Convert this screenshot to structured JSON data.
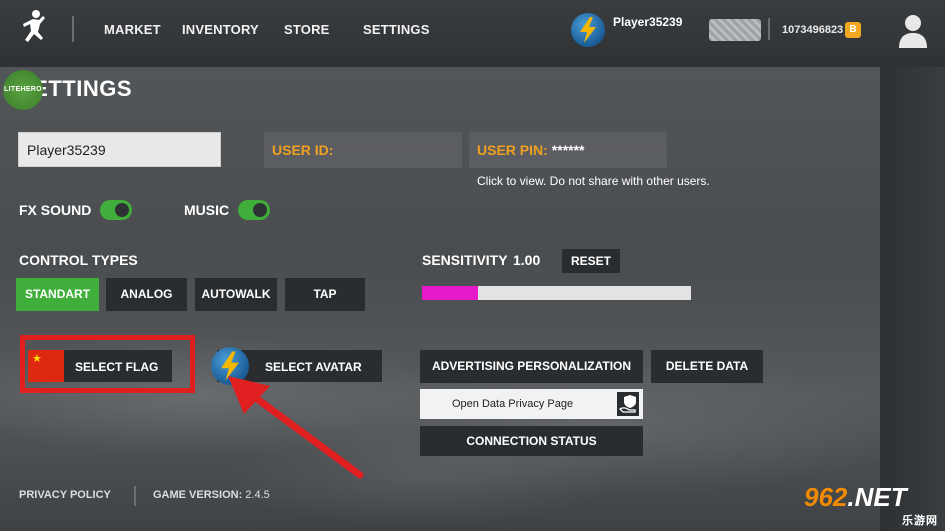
{
  "nav": {
    "items": [
      "MARKET",
      "INVENTORY",
      "STORE",
      "SETTINGS"
    ],
    "username": "Player35239",
    "coins": "1073496823",
    "coin_symbol": "B"
  },
  "page": {
    "title": "SETTINGS",
    "lite_badge": "LITEHERO"
  },
  "account": {
    "name_value": "Player35239",
    "user_id_label": "USER ID:",
    "user_pin_label": "USER PIN:",
    "user_pin_value": "******",
    "hint": "Click to view. Do not share with other users."
  },
  "audio": {
    "fx_label": "FX SOUND",
    "fx_on": true,
    "music_label": "MUSIC",
    "music_on": true
  },
  "controls": {
    "title": "CONTROL TYPES",
    "options": [
      "STANDART",
      "ANALOG",
      "AUTOWALK",
      "TAP"
    ],
    "selected": "STANDART"
  },
  "sensitivity": {
    "label": "SENSITIVITY",
    "value": "1.00",
    "reset_label": "RESET",
    "fill_fraction": 0.21
  },
  "actions": {
    "select_flag": "SELECT FLAG",
    "select_avatar": "SELECT AVATAR",
    "ad_personalization": "ADVERTISING PERSONALIZATION",
    "delete_data": "DELETE DATA",
    "open_privacy_page": "Open Data Privacy Page",
    "connection_status": "CONNECTION STATUS"
  },
  "footer": {
    "privacy_policy": "PRIVACY POLICY",
    "game_version_label": "GAME VERSION:",
    "game_version_value": "2.4.5"
  },
  "watermark": {
    "brand_main": "962",
    "brand_suffix": ".NET",
    "brand_sub": "乐游网"
  },
  "colors": {
    "accent_green": "#3fae3a",
    "label_orange": "#f0a020",
    "slider_pink": "#e619c8",
    "highlight_red": "#e02020"
  }
}
